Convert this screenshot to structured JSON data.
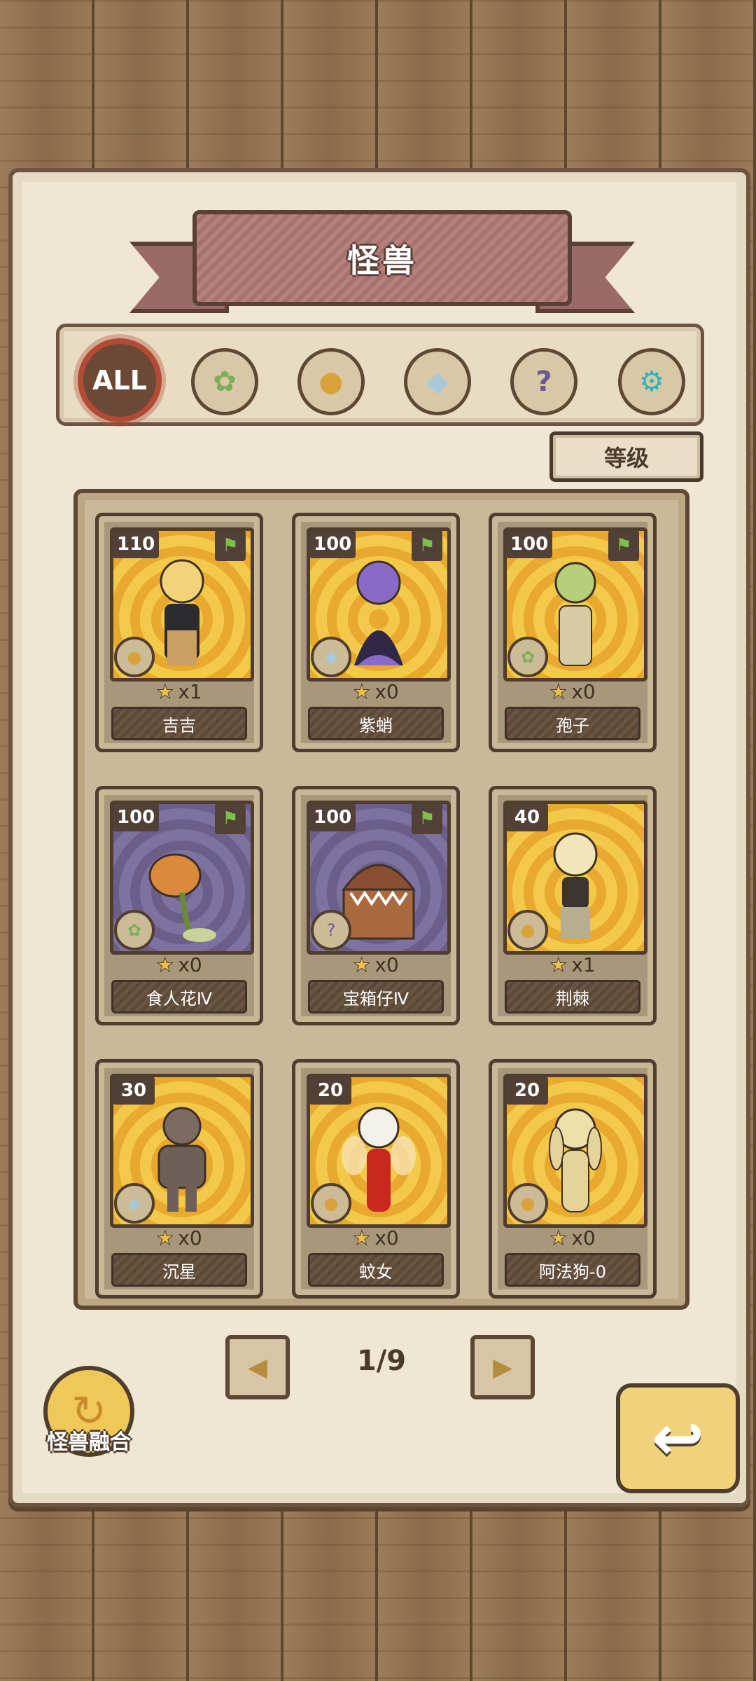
{
  "title": "怪兽",
  "filters": [
    {
      "label": "ALL",
      "icon": "all-icon",
      "active": true
    },
    {
      "label": "",
      "icon": "leaf-icon",
      "active": false
    },
    {
      "label": "",
      "icon": "paw-icon",
      "active": false
    },
    {
      "label": "",
      "icon": "crystal-icon",
      "active": false
    },
    {
      "label": "",
      "icon": "question-icon",
      "active": false
    },
    {
      "label": "",
      "icon": "gear-icon",
      "active": false
    }
  ],
  "sort_label": "等级",
  "cards": [
    {
      "level": "110",
      "name": "吉吉",
      "count": "x1",
      "type": "paw",
      "bg": "gold"
    },
    {
      "level": "100",
      "name": "紫蛸",
      "count": "x0",
      "type": "crystal",
      "bg": "gold"
    },
    {
      "level": "100",
      "name": "孢子",
      "count": "x0",
      "type": "leaf",
      "bg": "gold"
    },
    {
      "level": "100",
      "name": "食人花Ⅳ",
      "count": "x0",
      "type": "leaf",
      "bg": "purple"
    },
    {
      "level": "100",
      "name": "宝箱仔Ⅳ",
      "count": "x0",
      "type": "question",
      "bg": "purple"
    },
    {
      "level": "40",
      "name": "荆棘",
      "count": "x1",
      "type": "paw",
      "bg": "gold"
    },
    {
      "level": "30",
      "name": "沉星",
      "count": "x0",
      "type": "crystal",
      "bg": "gold"
    },
    {
      "level": "20",
      "name": "蚊女",
      "count": "x0",
      "type": "paw",
      "bg": "gold"
    },
    {
      "level": "20",
      "name": "阿法狗-0",
      "count": "x0",
      "type": "paw",
      "bg": "gold"
    }
  ],
  "pagination": {
    "indicator": "1/9"
  },
  "fusion_label": "怪兽融合",
  "colors": {
    "paper": "#efe7d3",
    "border": "#5e4734",
    "accent": "#b24b35",
    "gold_card": "#f2c94a"
  }
}
